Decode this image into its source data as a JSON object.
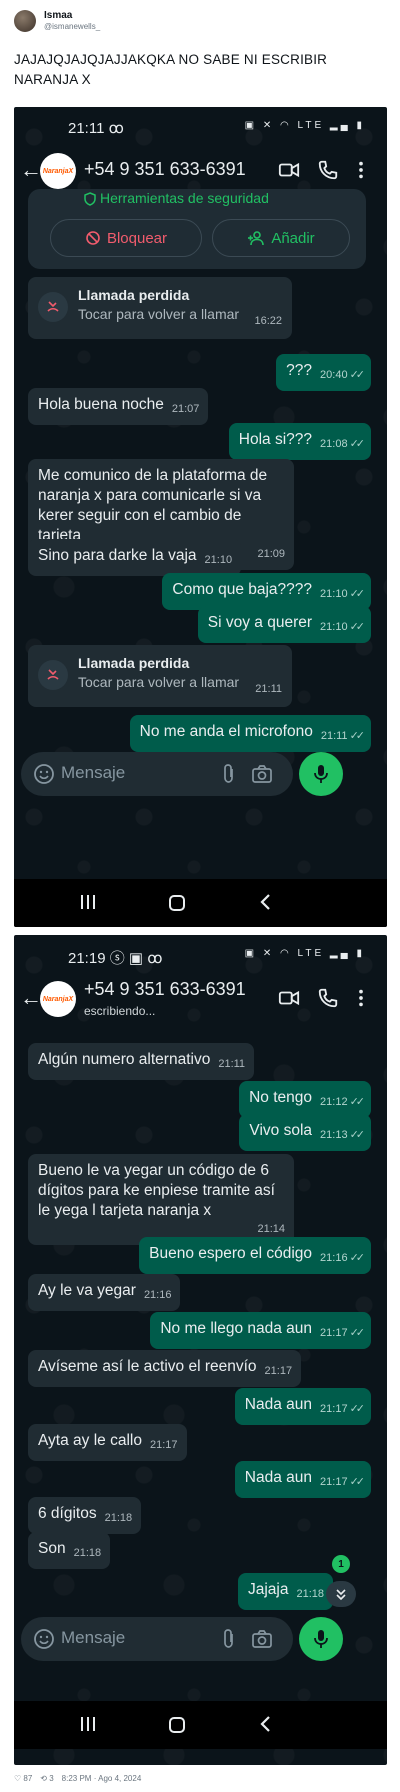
{
  "tweet": {
    "display_name": "Ismaa",
    "handle": "@ismanewells_",
    "text": "JAJAJQJAJQJAJJAKQKA NO SABE NI ESCRIBIR NARANJA X",
    "likes": "♡ 87",
    "retweets": "⟲ 3",
    "timestamp": "8:23 PM · Ago 4, 2024"
  },
  "contact": {
    "name": "+54 9 351 633-6391",
    "logo_text": "NaranjaX",
    "typing": "escribiendo..."
  },
  "screen1": {
    "time": "21:11 ꝏ",
    "status_icons": "▣ ✕ ◠ LTE ▂▄ ▮",
    "security": {
      "title": "Herramientas de seguridad",
      "block_label": "Bloquear",
      "add_label": "Añadir"
    },
    "messages": [
      {
        "type": "call",
        "title": "Llamada perdida",
        "sub": "Tocar para volver a llamar",
        "time": "16:22"
      },
      {
        "type": "out",
        "text": "???",
        "time": "20:40"
      },
      {
        "type": "in",
        "text": "Hola buena noche",
        "time": "21:07"
      },
      {
        "type": "out",
        "text": "Hola si???",
        "time": "21:08"
      },
      {
        "type": "in",
        "text": "Me comunico de la plataforma de naranja x para comunicarle si va kerer seguir con el cambio de tarjeta",
        "time": "21:09"
      },
      {
        "type": "in",
        "text": "Sino para darke la vaja",
        "time": "21:10"
      },
      {
        "type": "out",
        "text": "Como que baja????",
        "time": "21:10"
      },
      {
        "type": "out",
        "text": "Si voy a querer",
        "time": "21:10"
      },
      {
        "type": "call",
        "title": "Llamada perdida",
        "sub": "Tocar para volver a llamar",
        "time": "21:11"
      },
      {
        "type": "out",
        "text": "No me anda el microfono",
        "time": "21:11"
      }
    ],
    "input_placeholder": "Mensaje"
  },
  "screen2": {
    "time": "21:19 ⓢ ▣ ꝏ",
    "status_icons": "▣ ✕ ◠ LTE ▂▄ ▮",
    "messages": [
      {
        "type": "in",
        "text": "Algún numero alternativo",
        "time": "21:11"
      },
      {
        "type": "out",
        "text": "No tengo",
        "time": "21:12"
      },
      {
        "type": "out",
        "text": "Vivo sola",
        "time": "21:13"
      },
      {
        "type": "in",
        "text": "Bueno le va yegar un código de 6 dígitos para ke enpiese tramite  así le yega l tarjeta naranja x",
        "time": "21:14"
      },
      {
        "type": "out",
        "text": "Bueno espero el código",
        "time": "21:16"
      },
      {
        "type": "in",
        "text": "Ay le va yegar",
        "time": "21:16"
      },
      {
        "type": "out",
        "text": "No me llego nada aun",
        "time": "21:17"
      },
      {
        "type": "in",
        "text": "Avíseme así le activo el reenvío",
        "time": "21:17"
      },
      {
        "type": "out",
        "text": "Nada aun",
        "time": "21:17"
      },
      {
        "type": "in",
        "text": "Ayta ay le callo",
        "time": "21:17"
      },
      {
        "type": "out",
        "text": "Nada aun",
        "time": "21:17"
      },
      {
        "type": "in",
        "text": "6 dígitos",
        "time": "21:18"
      },
      {
        "type": "in",
        "text": "Son",
        "time": "21:18"
      },
      {
        "type": "out",
        "text": "Jajaja",
        "time": "21:18"
      }
    ],
    "unread_count": "1",
    "input_placeholder": "Mensaje"
  },
  "colors": {
    "chat_bg": "#0b141a",
    "incoming": "#202c33",
    "outgoing": "#005c4b",
    "accent": "#21c063",
    "danger": "#f15c6d"
  },
  "icons": [
    "back-arrow-icon",
    "video-call-icon",
    "phone-icon",
    "more-vert-icon",
    "missed-call-icon",
    "emoji-icon",
    "attach-icon",
    "camera-icon",
    "mic-icon",
    "shield-icon",
    "block-icon",
    "add-contact-icon"
  ]
}
